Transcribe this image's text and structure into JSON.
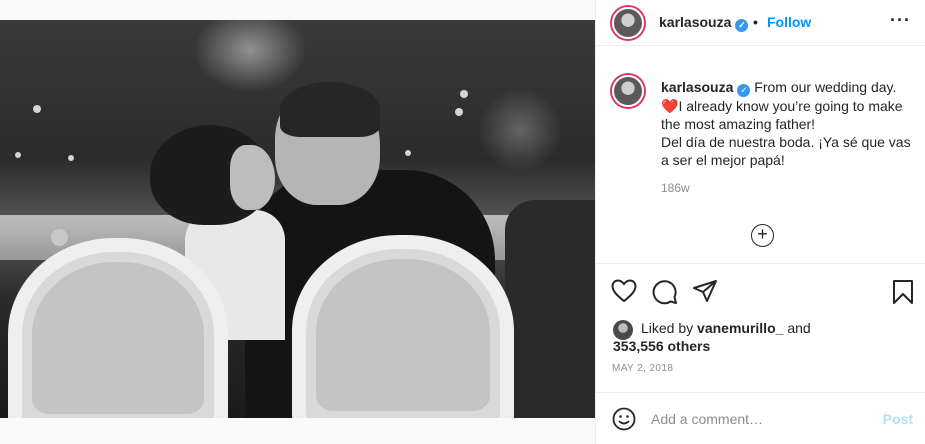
{
  "post": {
    "username": "karlasouza",
    "verified_mark": "✓",
    "separator": "•",
    "follow_label": "Follow",
    "more_label": "···",
    "caption_username": "karlasouza",
    "caption_line1": "From our wedding day.",
    "heart_emoji": "❤️",
    "caption_line2": "I already know you’re going to make the most amazing father!\nDel día de nuestra boda. ¡Ya sé que vas a ser el mejor papá!",
    "time_ago": "186w",
    "add_symbol": "+",
    "liked_prefix": "Liked by",
    "liked_user": "vanemurillo_",
    "liked_and": "and",
    "likes_count": "353,556 others",
    "date": "MAY 2, 2018",
    "comment_placeholder": "Add a comment…",
    "post_label": "Post"
  },
  "icons": [
    "heart-icon",
    "comment-icon",
    "share-icon",
    "bookmark-icon",
    "emoji-icon",
    "more-icon",
    "verified-icon"
  ],
  "colors": {
    "link": "#0095f6",
    "text": "#262626",
    "muted": "#8e8e8e",
    "post_disabled": "#b2dffc",
    "verified": "#3897f0"
  }
}
